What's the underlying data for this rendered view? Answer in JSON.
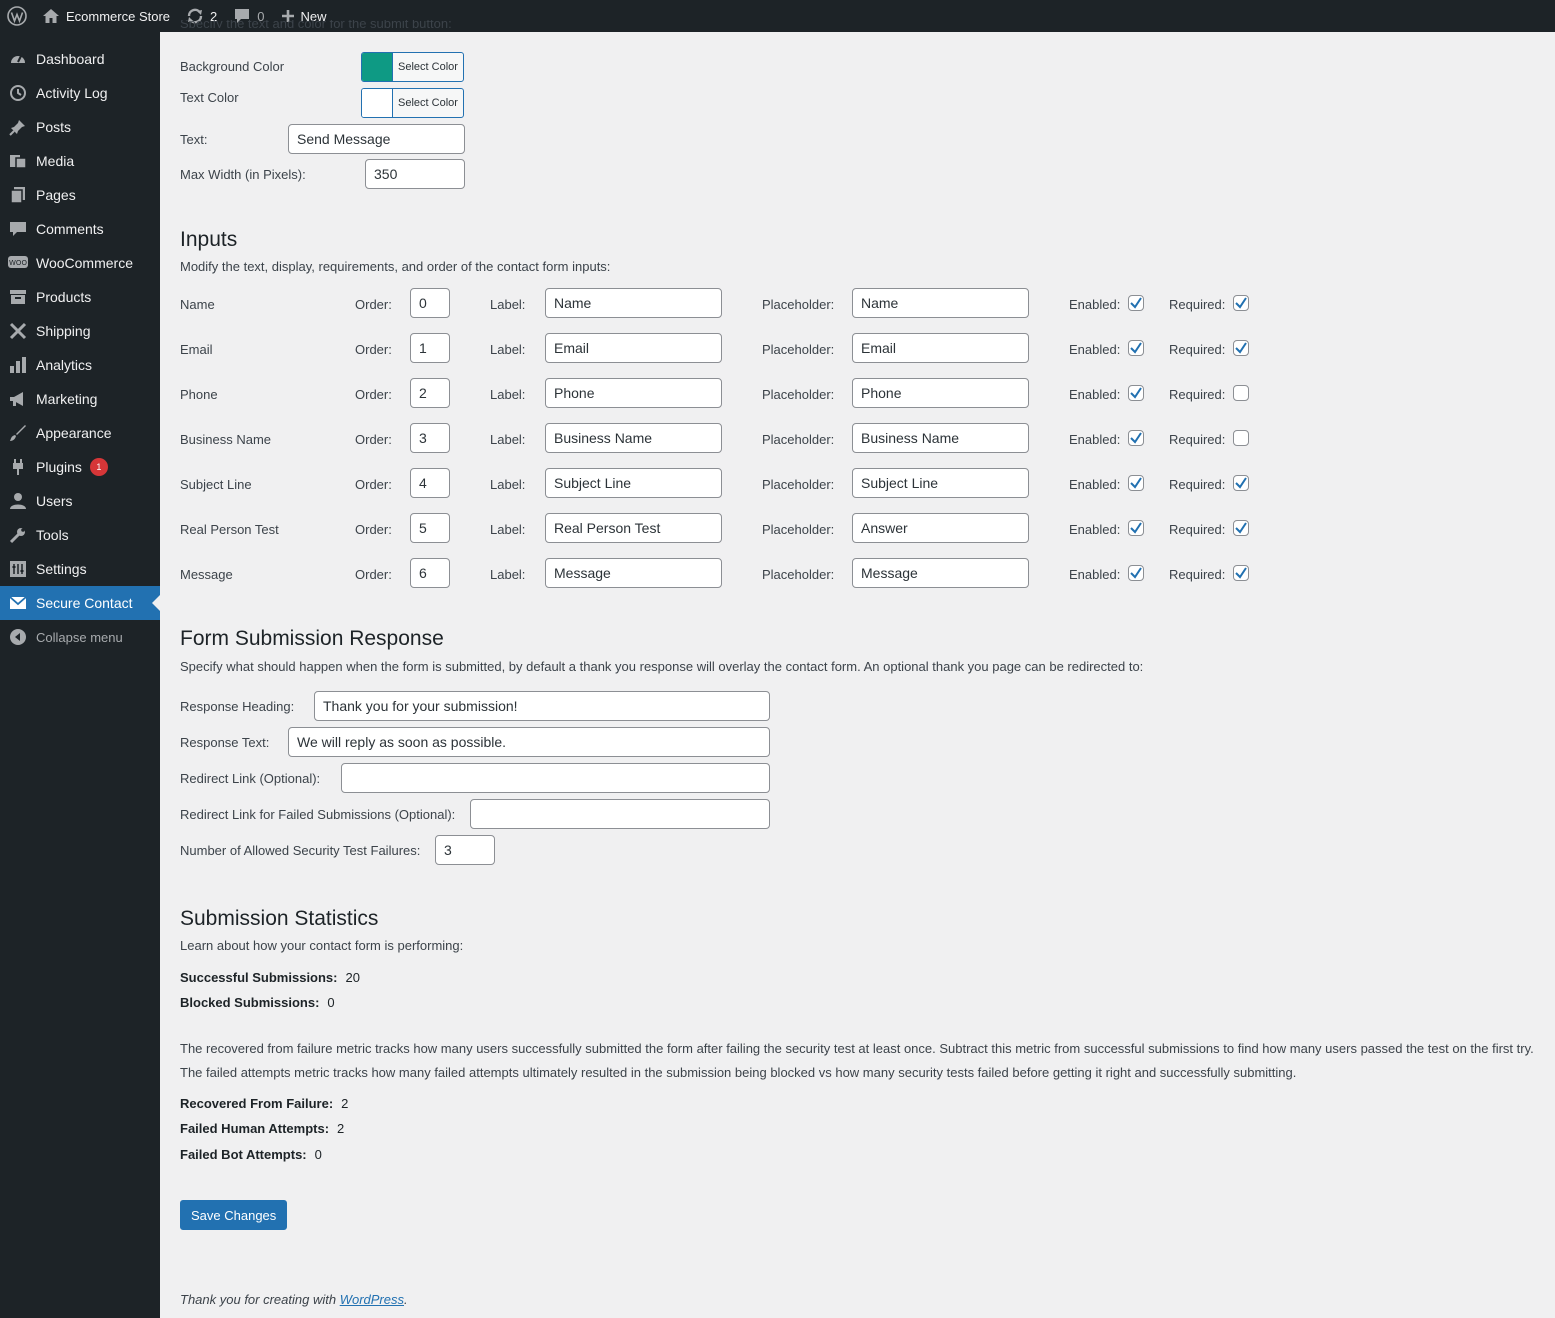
{
  "adminbar": {
    "site_name": "Ecommerce Store",
    "updates_count": "2",
    "comments_count": "0",
    "new_label": "New"
  },
  "sidebar": {
    "items": [
      {
        "label": "Dashboard",
        "icon": "dashboard-icon"
      },
      {
        "label": "Activity Log",
        "icon": "history-icon"
      },
      {
        "label": "Posts",
        "icon": "pin-icon"
      },
      {
        "label": "Media",
        "icon": "media-icon"
      },
      {
        "label": "Pages",
        "icon": "pages-icon"
      },
      {
        "label": "Comments",
        "icon": "comment-icon"
      },
      {
        "label": "WooCommerce",
        "icon": "woo-icon"
      },
      {
        "label": "Products",
        "icon": "archive-icon"
      },
      {
        "label": "Shipping",
        "icon": "tools-cross-icon"
      },
      {
        "label": "Analytics",
        "icon": "bar-chart-icon"
      },
      {
        "label": "Marketing",
        "icon": "megaphone-icon"
      },
      {
        "label": "Appearance",
        "icon": "brush-icon"
      },
      {
        "label": "Plugins",
        "icon": "plug-icon",
        "badge": "1"
      },
      {
        "label": "Users",
        "icon": "user-icon"
      },
      {
        "label": "Tools",
        "icon": "wrench-icon"
      },
      {
        "label": "Settings",
        "icon": "sliders-icon"
      },
      {
        "label": "Secure Contact",
        "icon": "mail-icon",
        "current": true
      }
    ],
    "collapse_label": "Collapse menu"
  },
  "submit_button": {
    "intro_text": "Specify the text and color for the submit button:",
    "bg_color_label": "Background Color",
    "bg_color_value": "#0e9a84",
    "text_color_label": "Text Color",
    "text_color_value": "#ffffff",
    "select_color_label": "Select Color",
    "text_label": "Text:",
    "text_value": "Send Message",
    "max_width_label": "Max Width (in Pixels):",
    "max_width_value": "350"
  },
  "inputs": {
    "heading": "Inputs",
    "description": "Modify the text, display, requirements, and order of the contact form inputs:",
    "order_label": "Order:",
    "label_label": "Label:",
    "placeholder_label": "Placeholder:",
    "enabled_label": "Enabled:",
    "required_label": "Required:",
    "rows": [
      {
        "name": "Name",
        "order": "0",
        "label": "Name",
        "placeholder": "Name",
        "enabled": true,
        "required": true
      },
      {
        "name": "Email",
        "order": "1",
        "label": "Email",
        "placeholder": "Email",
        "enabled": true,
        "required": true
      },
      {
        "name": "Phone",
        "order": "2",
        "label": "Phone",
        "placeholder": "Phone",
        "enabled": true,
        "required": false
      },
      {
        "name": "Business Name",
        "order": "3",
        "label": "Business Name",
        "placeholder": "Business Name",
        "enabled": true,
        "required": false
      },
      {
        "name": "Subject Line",
        "order": "4",
        "label": "Subject Line",
        "placeholder": "Subject Line",
        "enabled": true,
        "required": true
      },
      {
        "name": "Real Person Test",
        "order": "5",
        "label": "Real Person Test",
        "placeholder": "Answer",
        "enabled": true,
        "required": true
      },
      {
        "name": "Message",
        "order": "6",
        "label": "Message",
        "placeholder": "Message",
        "enabled": true,
        "required": true
      }
    ]
  },
  "response": {
    "heading": "Form Submission Response",
    "description": "Specify what should happen when the form is submitted, by default a thank you response will overlay the contact form. An optional thank you page can be redirected to:",
    "heading_label": "Response Heading:",
    "heading_value": "Thank you for your submission!",
    "text_label": "Response Text:",
    "text_value": "We will reply as soon as possible.",
    "redirect_label": "Redirect Link (Optional):",
    "redirect_value": "",
    "redirect_failed_label": "Redirect Link for Failed Submissions (Optional):",
    "redirect_failed_value": "",
    "failures_label": "Number of Allowed Security Test Failures:",
    "failures_value": "3"
  },
  "stats": {
    "heading": "Submission Statistics",
    "description": "Learn about how your contact form is performing:",
    "successful_label": "Successful Submissions:",
    "successful_value": "20",
    "blocked_label": "Blocked Submissions:",
    "blocked_value": "0",
    "recovered_explain": "The recovered from failure metric tracks how many users successfully submitted the form after failing the security test at least once. Subtract this metric from successful submissions to find how many users passed the test on the first try.",
    "failed_explain": "The failed attempts metric tracks how many failed attempts ultimately resulted in the submission being blocked vs how many security tests failed before getting it right and successfully submitting.",
    "recovered_label": "Recovered From Failure:",
    "recovered_value": "2",
    "failed_human_label": "Failed Human Attempts:",
    "failed_human_value": "2",
    "failed_bot_label": "Failed Bot Attempts:",
    "failed_bot_value": "0"
  },
  "save_label": "Save Changes",
  "footer": {
    "prefix": "Thank you for creating with ",
    "link": "WordPress",
    "suffix": "."
  }
}
